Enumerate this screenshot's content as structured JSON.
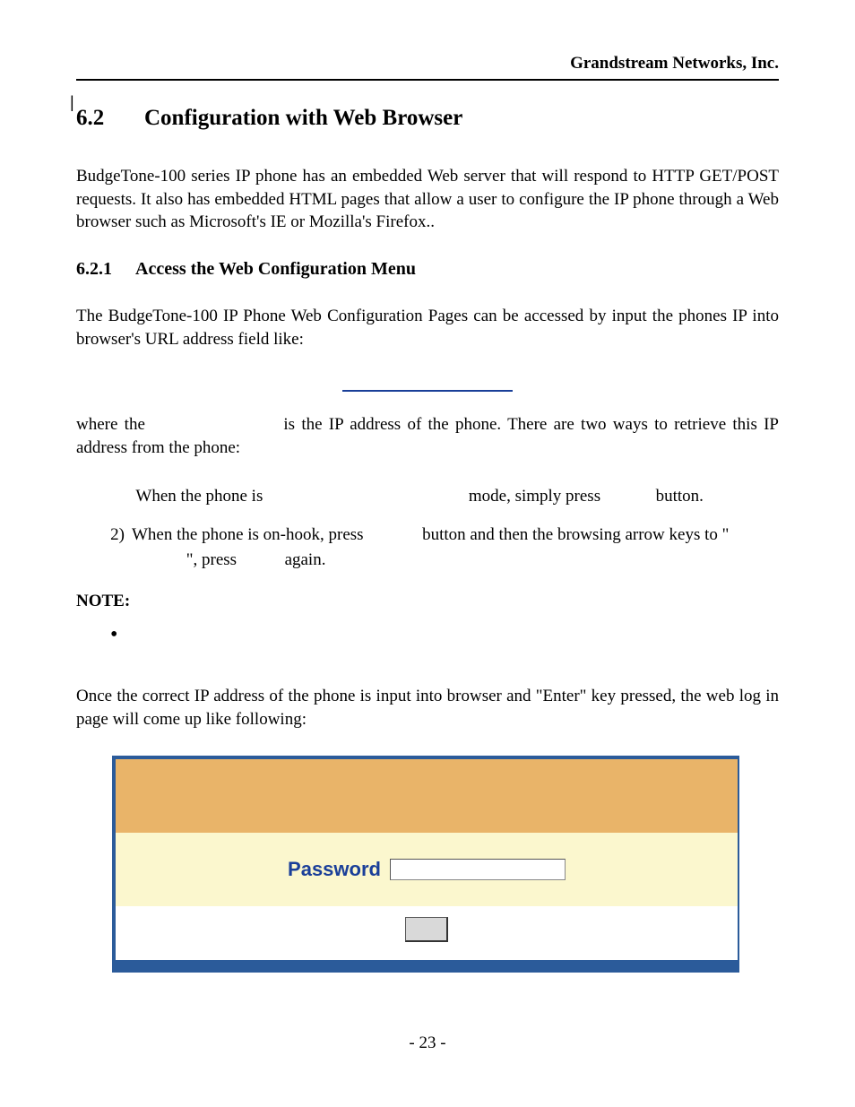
{
  "header": {
    "company": "Grandstream Networks, Inc."
  },
  "section": {
    "number": "6.2",
    "title": "Configuration with Web Browser",
    "intro": "BudgeTone-100 series IP phone has an embedded Web server that will respond to HTTP GET/POST requests. It also has embedded HTML pages that allow a user to configure the IP phone through a Web browser such as Microsoft's IE or Mozilla's Firefox.."
  },
  "subsection": {
    "number": "6.2.1",
    "title": "Access the Web Configuration Menu",
    "p1": "The BudgeTone-100 IP Phone Web Configuration Pages can be accessed by input the phones IP into browser's URL address field like:",
    "p2_pre": "where the",
    "p2_post": "is the IP address of the phone. There are two ways to retrieve this IP address from the phone:",
    "li1_a": "When  the  phone  is",
    "li1_b": "mode,  simply  press",
    "li1_c": "button.",
    "li2_mark": "2)",
    "li2_a": "When  the  phone  is  on-hook,  press",
    "li2_b": "button  and  then  the  browsing  arrow  keys  to  \"",
    "li2_c": "\", press",
    "li2_d": "again.",
    "note_label": "NOTE:",
    "p3": "Once the correct IP address of the phone is input into browser and \"Enter\" key pressed, the web log in page will come up like following:"
  },
  "login": {
    "password_label": "Password",
    "input_value": "",
    "button_label": ""
  },
  "footer": {
    "page": "- 23 -"
  }
}
